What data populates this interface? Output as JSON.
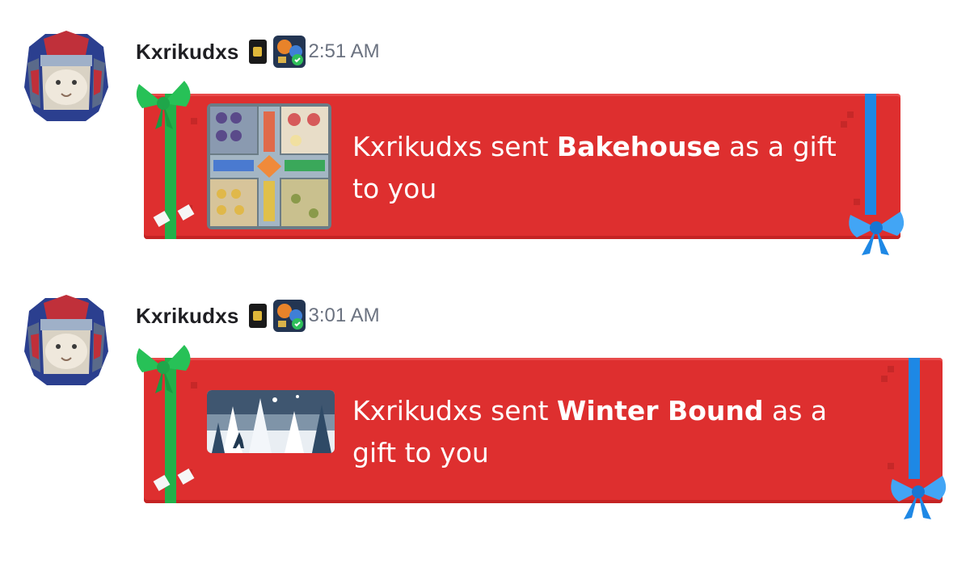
{
  "messages": [
    {
      "username": "Kxrikudxs",
      "timestamp": "2:51 AM",
      "gift": {
        "prefix": "Kxrikudxs sent ",
        "item_name": "Bakehouse",
        "suffix": " as a gift to you",
        "thumbnail": "bakehouse-board-game-art"
      }
    },
    {
      "username": "Kxrikudxs",
      "timestamp": "3:01 AM",
      "gift": {
        "prefix": "Kxrikudxs sent ",
        "item_name": "Winter Bound",
        "suffix": " as a gift to you",
        "thumbnail": "winter-forest-deer-art"
      }
    }
  ],
  "colors": {
    "gift_card_red": "#de2f2f",
    "ribbon_green": "#22b04a",
    "ribbon_blue": "#1e88e5",
    "username": "#1f1f23",
    "timestamp": "#6b7280"
  },
  "icons": [
    "user-avatar-icon",
    "game-dice-badge-icon",
    "game-badge-icon",
    "green-bow-icon",
    "blue-bow-icon"
  ]
}
